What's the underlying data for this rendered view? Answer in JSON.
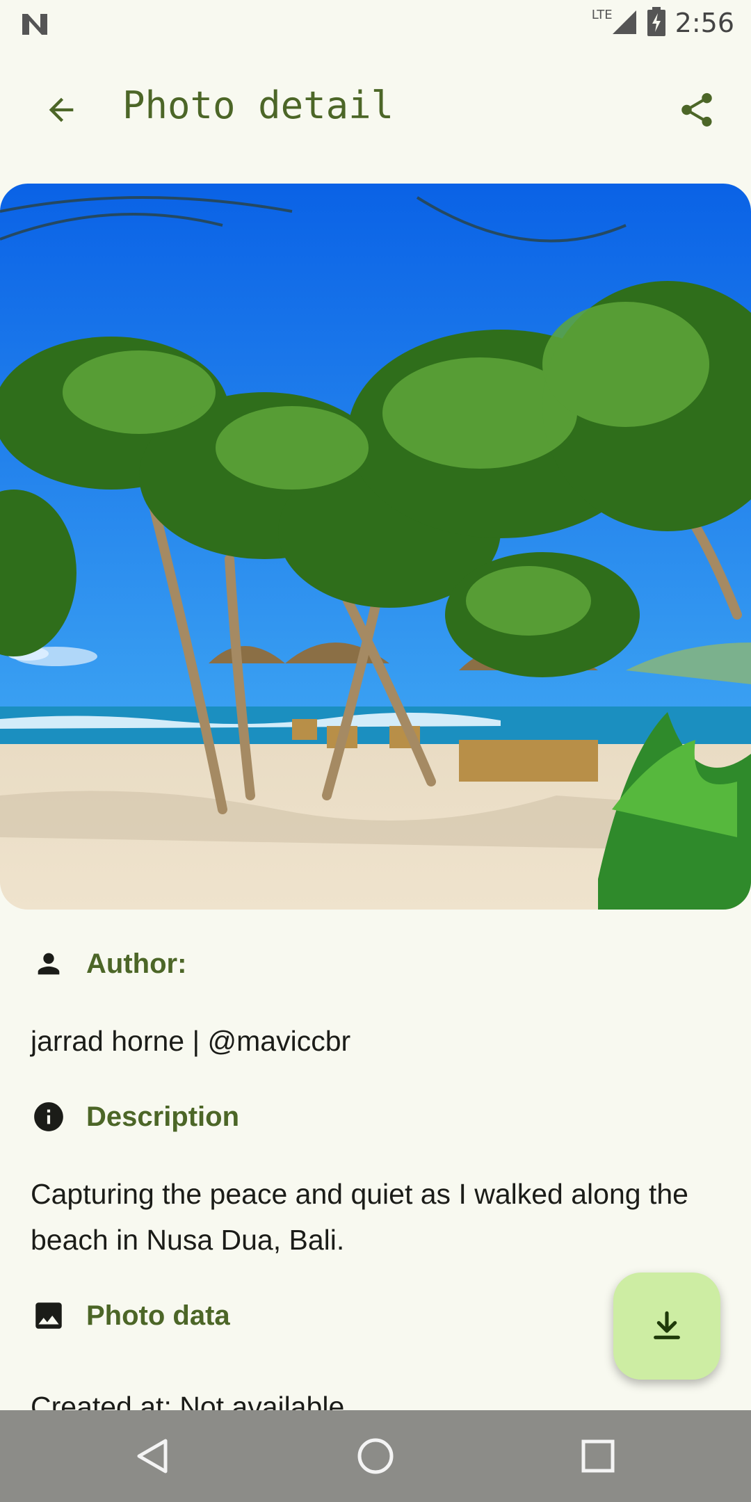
{
  "status_bar": {
    "time": "2:56",
    "network": "LTE"
  },
  "app_bar": {
    "title": "Photo detail"
  },
  "photo": {
    "alt": "Beach in Nusa Dua, Bali"
  },
  "sections": {
    "author": {
      "title": "Author:",
      "value": "jarrad horne | @maviccbr"
    },
    "description": {
      "title": "Description",
      "value": "Capturing the peace and quiet as I walked along the beach in Nusa Dua, Bali."
    },
    "photo_data": {
      "title": "Photo data",
      "created_at": "Created at: Not available"
    }
  },
  "colors": {
    "accent": "#4c6627",
    "fab": "#cdeda3",
    "background": "#f8f9f0",
    "nav_bar": "#8c8c88"
  },
  "icons": [
    "n-logo-icon",
    "lte-icon",
    "signal-icon",
    "battery-charging-icon",
    "back-arrow-icon",
    "share-icon",
    "person-icon",
    "info-icon",
    "image-icon",
    "download-icon",
    "nav-back-icon",
    "nav-home-icon",
    "nav-recents-icon"
  ]
}
